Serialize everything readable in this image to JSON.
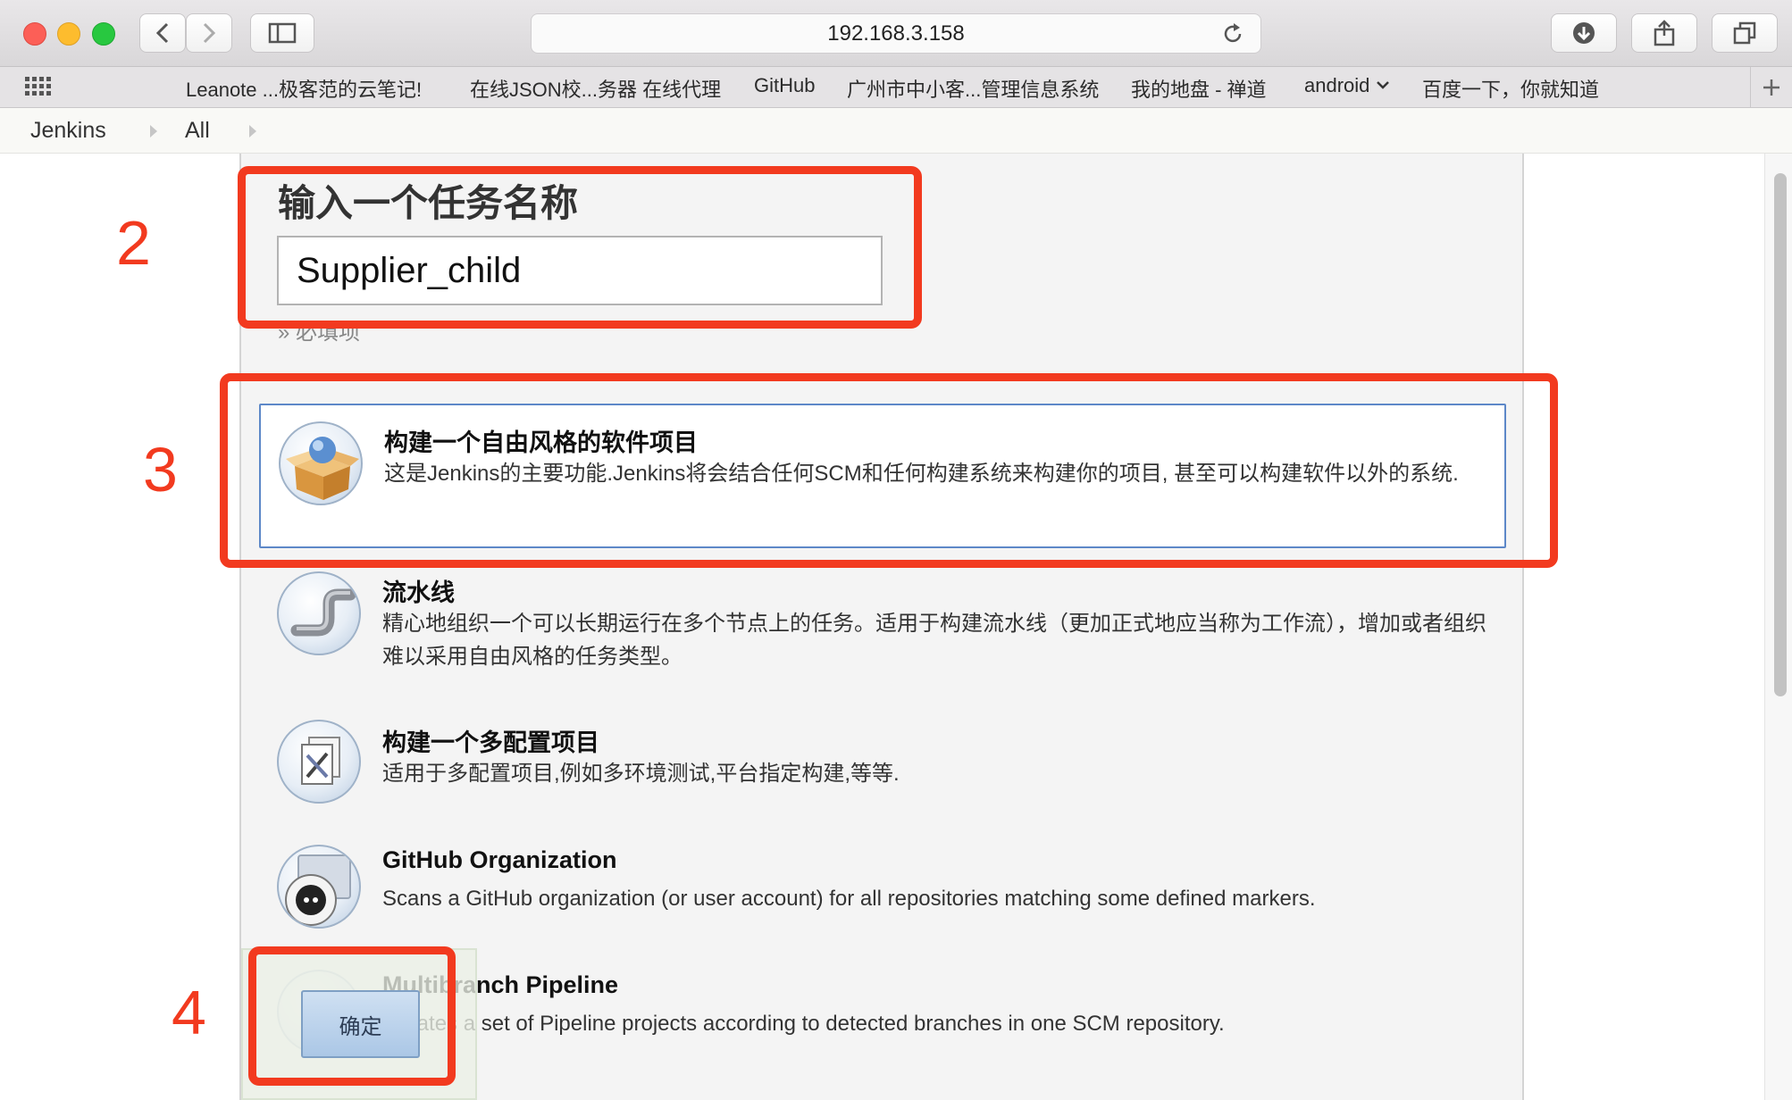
{
  "browser": {
    "url": "192.168.3.158",
    "favorites": [
      "Leanote ...极客范的云笔记!",
      "在线JSON校...务器 在线代理",
      "GitHub",
      "广州市中小客...管理信息系统",
      "我的地盘 - 禅道",
      "android",
      "百度一下，你就知道"
    ]
  },
  "breadcrumb": [
    "Jenkins",
    "All"
  ],
  "form": {
    "heading": "输入一个任务名称",
    "job_name": "Supplier_child",
    "required_hint": "» 必填项"
  },
  "job_types": [
    {
      "title": "构建一个自由风格的软件项目",
      "description": "这是Jenkins的主要功能.Jenkins将会结合任何SCM和任何构建系统来构建你的项目, 甚至可以构建软件以外的系统."
    },
    {
      "title": "流水线",
      "description": "精心地组织一个可以长期运行在多个节点上的任务。适用于构建流水线（更加正式地应当称为工作流），增加或者组织难以采用自由风格的任务类型。"
    },
    {
      "title": "构建一个多配置项目",
      "description": "适用于多配置项目,例如多环境测试,平台指定构建,等等."
    },
    {
      "title": "GitHub Organization",
      "description": "Scans a GitHub organization (or user account) for all repositories matching some defined markers."
    },
    {
      "title": "Multibranch Pipeline",
      "description": "Creates a set of Pipeline projects according to detected branches in one SCM repository."
    }
  ],
  "ok_button": "确定",
  "annotations": [
    "2",
    "3",
    "4"
  ],
  "colors": {
    "annotation": "#f23a1f",
    "selected_border": "#5d88c8",
    "ok_button": "#b9d0ea"
  }
}
